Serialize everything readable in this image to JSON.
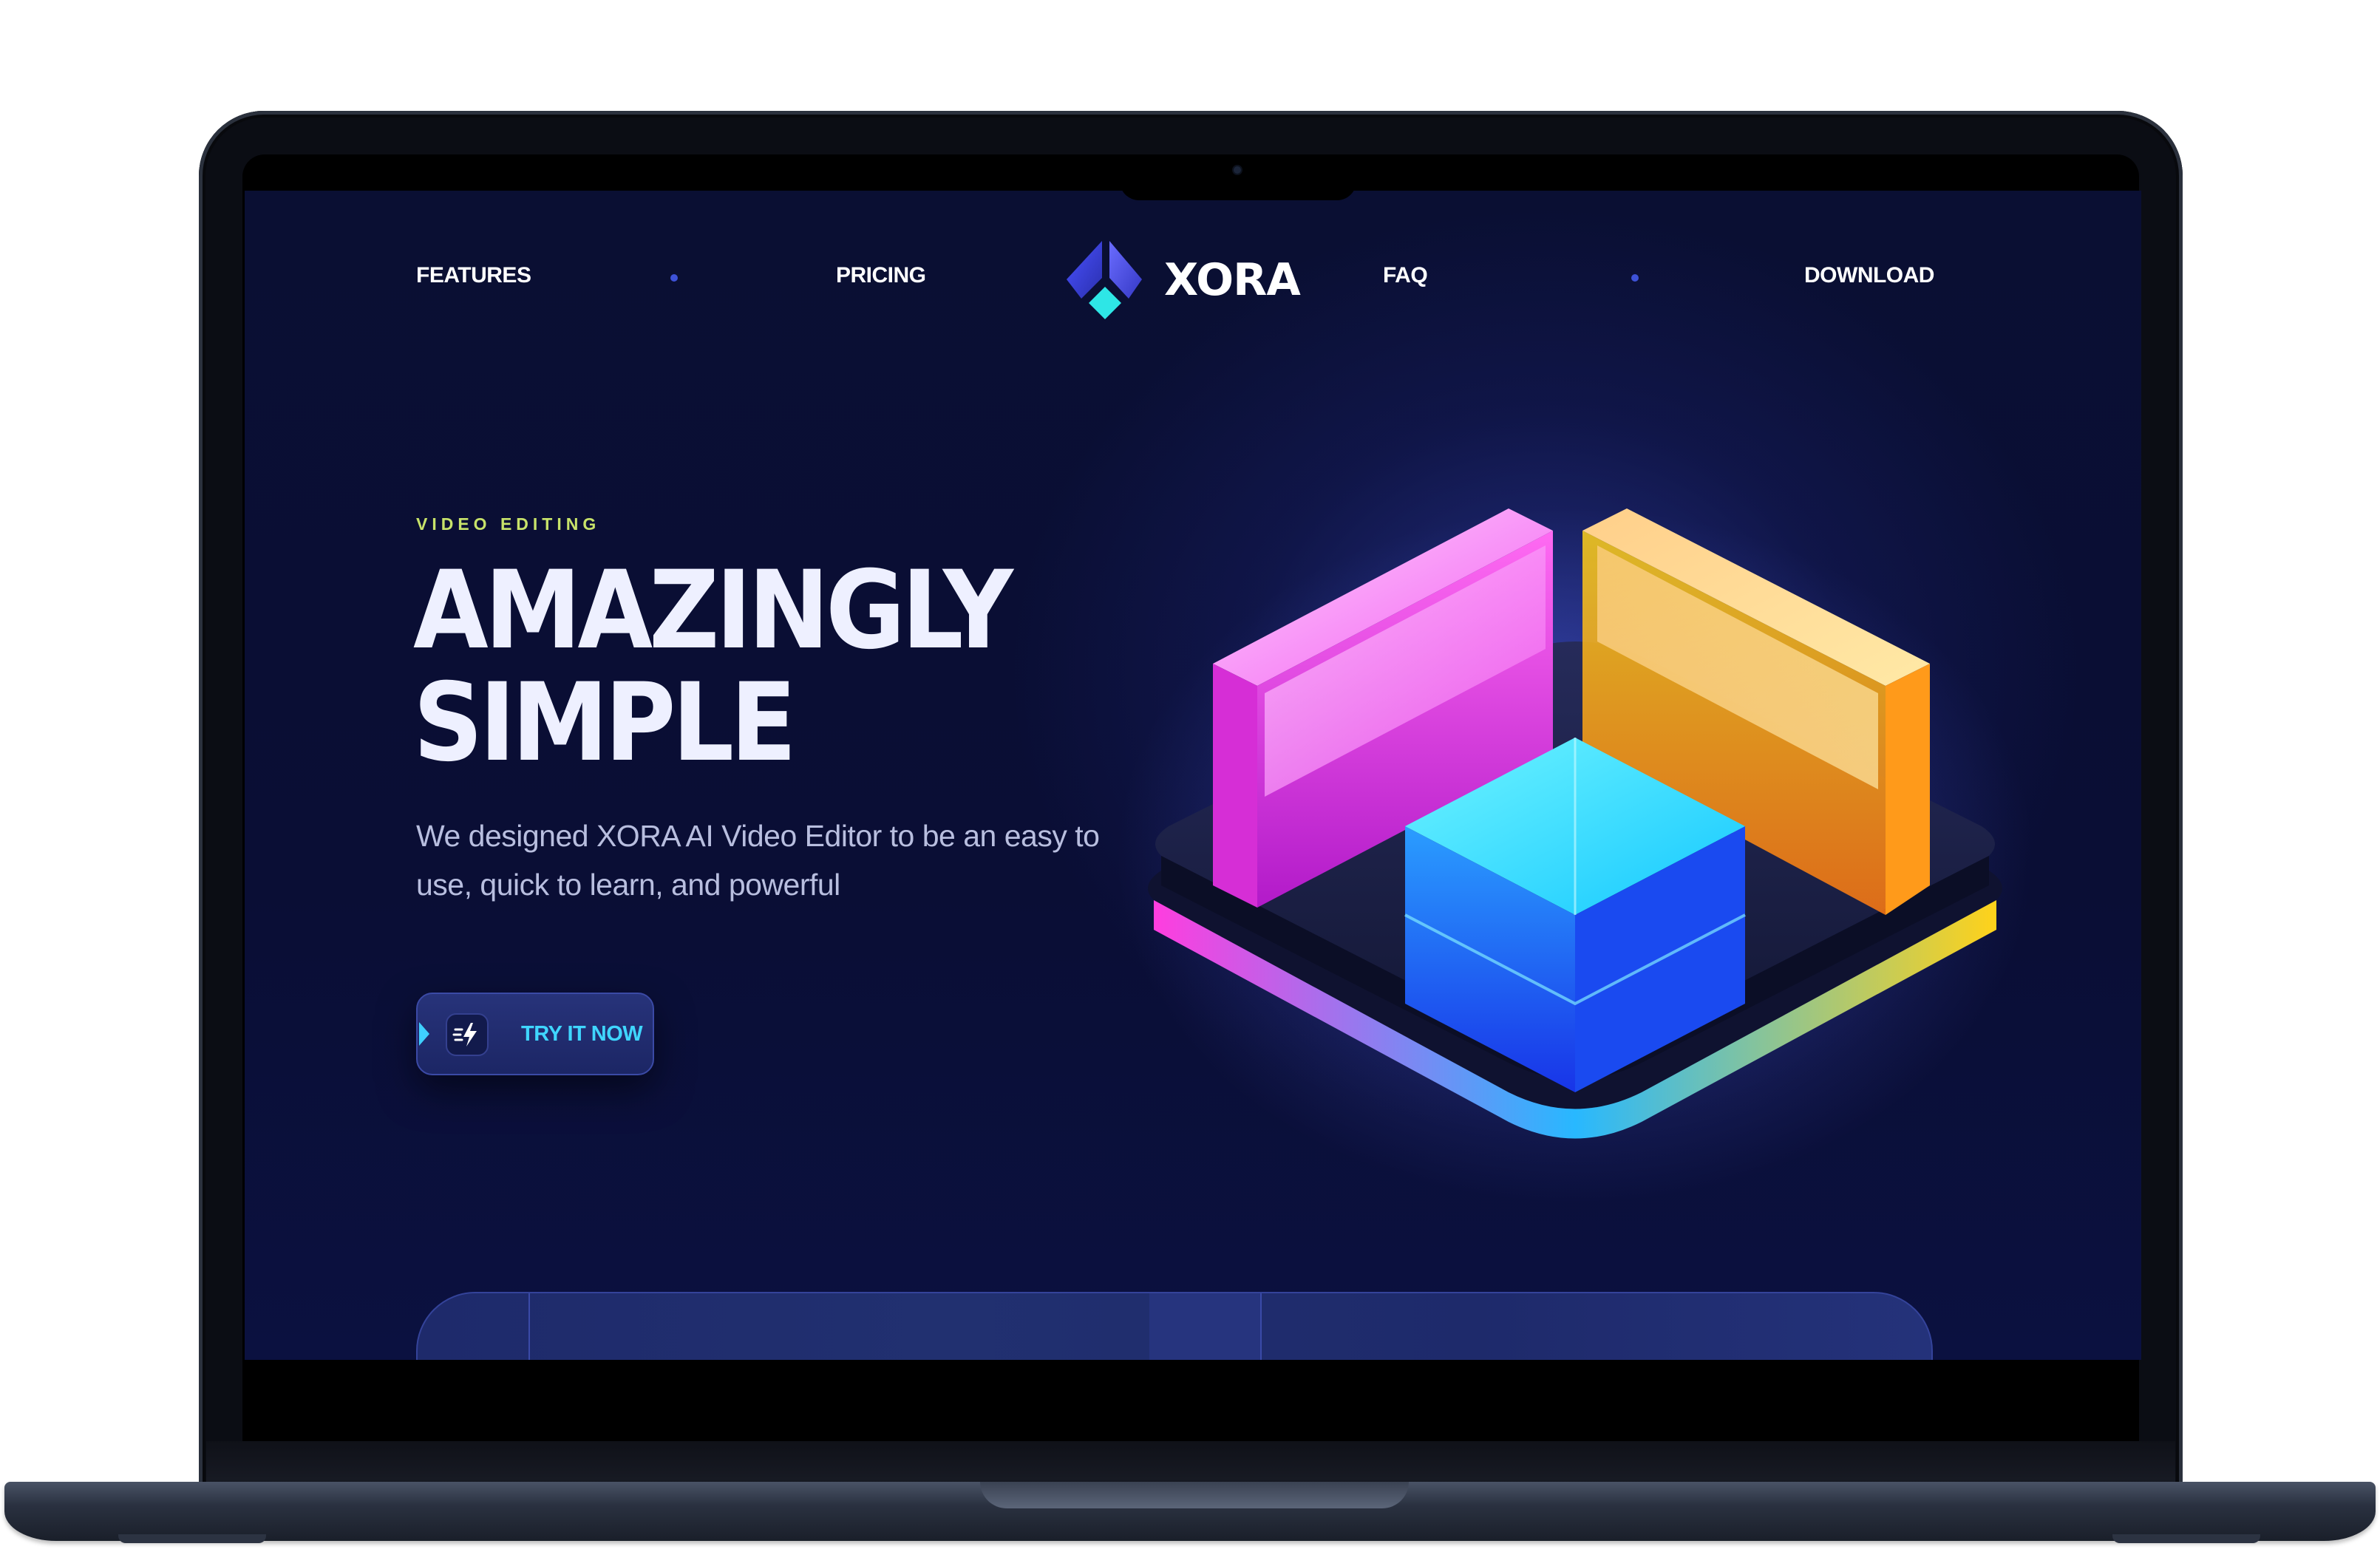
{
  "nav": {
    "left_links": [
      "FEATURES",
      "PRICING"
    ],
    "right_links": [
      "FAQ",
      "DOWNLOAD"
    ],
    "logo_text": "XORA"
  },
  "hero": {
    "eyebrow": "VIDEO EDITING",
    "headline_line1": "AMAZINGLY",
    "headline_line2": "SIMPLE",
    "description": "We designed XORA AI Video Editor to be an easy to use, quick to learn, and powerful",
    "cta_label": "TRY IT NOW",
    "cta_icon": "lightning-icon",
    "art_icon": "glass-blocks-illustration"
  },
  "colors": {
    "background": "#0a0e35",
    "eyebrow": "#c8e36a",
    "accent": "#3fd6ff",
    "nav_dot": "#3e52d8",
    "logo_blue": "#3a3fd6",
    "logo_cyan": "#2ee6e6"
  }
}
